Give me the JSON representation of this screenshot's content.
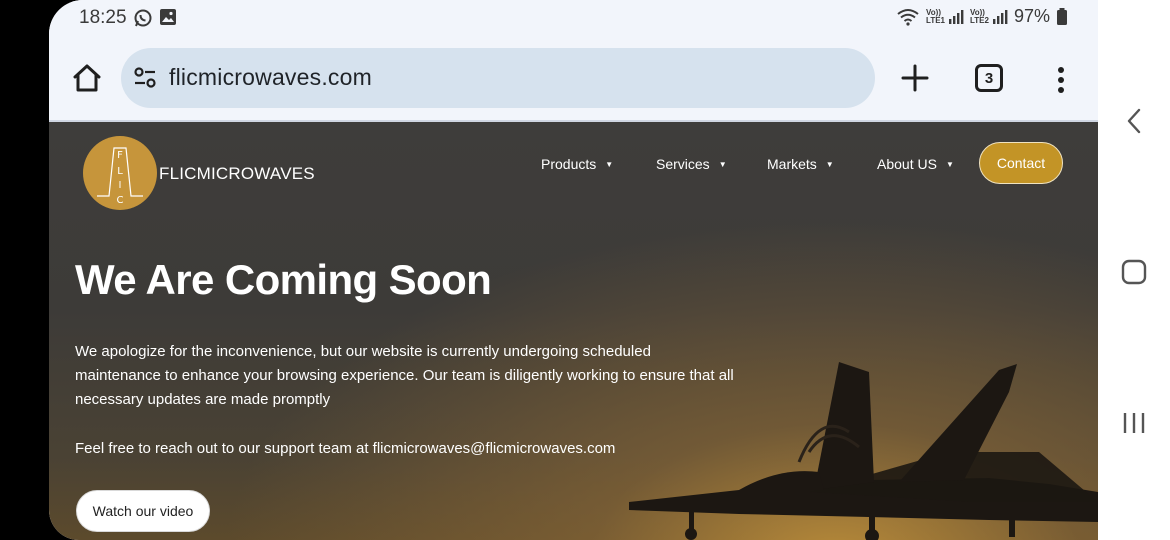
{
  "status_bar": {
    "time": "18:25",
    "left_icons": [
      "whatsapp-icon",
      "image-icon"
    ],
    "right_icons": [
      "wifi-icon",
      "lte1-signal-icon",
      "lte2-signal-icon",
      "battery-icon"
    ],
    "lte1_label_top": "Vo))",
    "lte1_label_bottom": "LTE1",
    "lte2_label_top": "Vo))",
    "lte2_label_bottom": "LTE2",
    "battery": "97%"
  },
  "browser": {
    "url": "flicmicrowaves.com",
    "tab_count": "3",
    "icons": [
      "home-icon",
      "site-settings-icon",
      "plus-icon",
      "tabs-icon",
      "more-vert-icon"
    ]
  },
  "site": {
    "brand": "FLICMICROWAVES",
    "logo_letters": [
      "F",
      "L",
      "I",
      "C"
    ],
    "nav": [
      {
        "label": "Products"
      },
      {
        "label": "Services"
      },
      {
        "label": "Markets"
      },
      {
        "label": "About US"
      }
    ],
    "contact_label": "Contact",
    "headline": "We Are Coming Soon",
    "paragraph": "We apologize for the inconvenience, but our website is currently undergoing scheduled maintenance to enhance your browsing experience. Our team is diligently working to ensure that all necessary updates are made promptly",
    "support": "Feel free to reach out to our support team at flicmicrowaves@flicmicrowaves.com",
    "video_button": "Watch our video"
  },
  "colors": {
    "accent_gold": "#c39426",
    "logo_gold": "#c6953b",
    "url_bar": "#d6e2ee",
    "chrome_bg": "#f2f5fb"
  }
}
